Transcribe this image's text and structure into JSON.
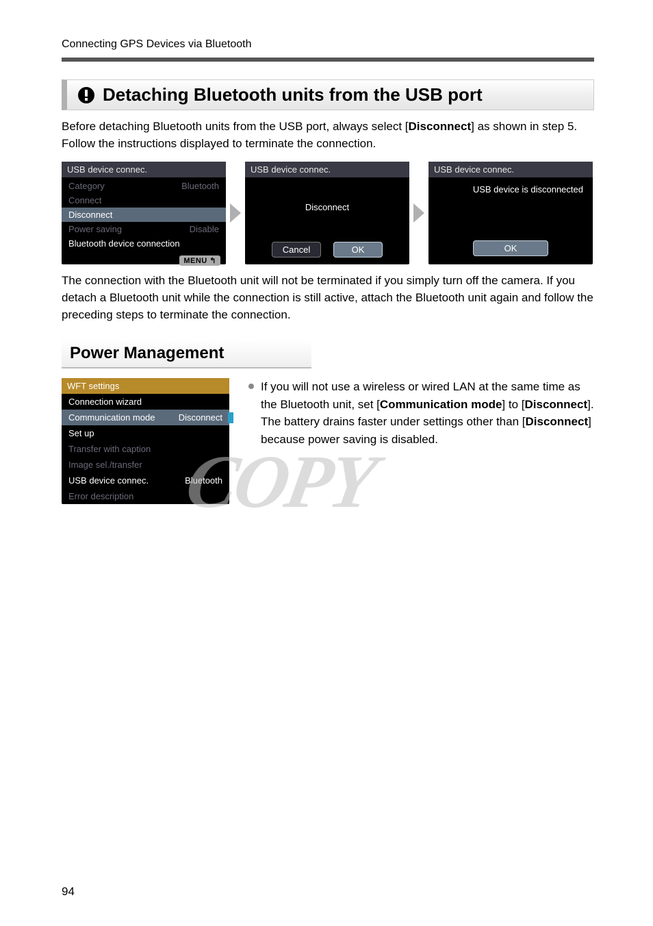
{
  "header": {
    "running_head": "Connecting GPS Devices via Bluetooth"
  },
  "section1": {
    "icon_name": "warning-exclaim-icon",
    "title": "Detaching Bluetooth units from the USB port",
    "intro_pre": "Before detaching Bluetooth units from the USB port, always select [",
    "intro_bold": "Disconnect",
    "intro_post": "] as shown in step 5. Follow the instructions displayed to terminate the connection."
  },
  "screens": {
    "s1": {
      "title": "USB device connec.",
      "rows": [
        {
          "label": "Category",
          "value": "Bluetooth",
          "state": "dim"
        },
        {
          "label": "Connect",
          "value": "",
          "state": "dim"
        },
        {
          "label": "Disconnect",
          "value": "",
          "state": "sel"
        },
        {
          "label": "Power saving",
          "value": "Disable",
          "state": "dim"
        },
        {
          "label": "Bluetooth device connection",
          "value": "",
          "state": "enabled"
        }
      ],
      "footer_badge": "MENU"
    },
    "s2": {
      "title": "USB device connec.",
      "center_text": "Disconnect",
      "btn_cancel": "Cancel",
      "btn_ok": "OK"
    },
    "s3": {
      "title": "USB device connec.",
      "message": "USB device is disconnected",
      "btn_ok": "OK"
    }
  },
  "after_screens": "The connection with the Bluetooth unit will not be terminated if you simply turn off the camera. If you detach a Bluetooth unit while the connection is still active, attach the Bluetooth unit again and follow the preceding steps to terminate the connection.",
  "section2": {
    "title": "Power Management"
  },
  "wft": {
    "title": "WFT settings",
    "rows": [
      {
        "label": "Connection wizard",
        "value": "",
        "state": "enabled"
      },
      {
        "label": "Communication mode",
        "value": "Disconnect",
        "state": "sel",
        "mark": true
      },
      {
        "label": "Set up",
        "value": "",
        "state": "enabled"
      },
      {
        "label": "Transfer with caption",
        "value": "",
        "state": "dim"
      },
      {
        "label": "Image sel./transfer",
        "value": "",
        "state": "dim"
      },
      {
        "label": "USB device connec.",
        "value": "Bluetooth",
        "state": "enabled"
      },
      {
        "label": "Error description",
        "value": "",
        "state": "dim"
      }
    ]
  },
  "bullet": {
    "p1": "If you will not use a wireless or wired LAN at the same time as the Bluetooth unit, set [",
    "b1": "Communication mode",
    "p2": "] to [",
    "b2": "Disconnect",
    "p3": "]. The battery drains faster under settings other than [",
    "b3": "Disconnect",
    "p4": "] because power saving is disabled."
  },
  "watermark": "COPY",
  "page_number": "94"
}
